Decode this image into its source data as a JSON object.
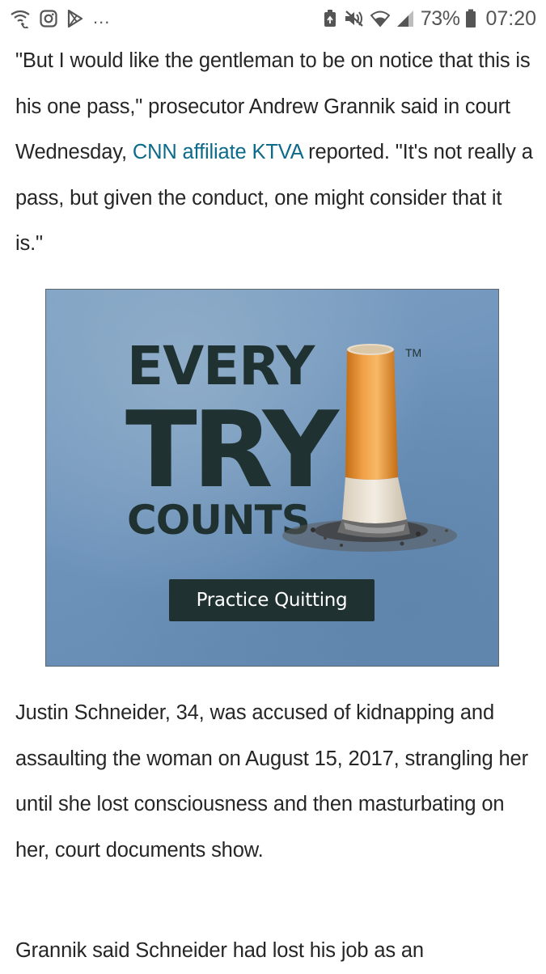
{
  "status_bar": {
    "left_icons": [
      "wifi-calling-icon",
      "instagram-icon",
      "play-store-icon"
    ],
    "more": "...",
    "right_icons": [
      "recycle-icon",
      "mute-icon",
      "wifi-icon",
      "signal-icon"
    ],
    "battery_percent": "73%",
    "battery_icon": "battery-icon",
    "time": "07:20"
  },
  "article": {
    "paragraph_1": {
      "before_link": "\"But I would like the gentleman to be on notice that this is his one pass,\" prosecutor Andrew Grannik said in court Wednesday, ",
      "link_text": "CNN affiliate KTVA",
      "after_link": " reported. \"It's not really a pass, but given the conduct, one might consider that it is.\""
    },
    "paragraph_2": "Justin Schneider, 34, was accused of kidnapping and assaulting the woman on August 15, 2017, strangling her until she lost consciousness and then masturbating on her, court documents show.",
    "paragraph_3": "Grannik said Schneider had lost his job as an"
  },
  "ad": {
    "line_1": "EVERY",
    "line_2": "TRY",
    "line_3": "COUNTS",
    "trademark": "TM",
    "button_label": "Practice Quitting",
    "colors": {
      "background": "#6e93bb",
      "text": "#1f3231",
      "button": "#1f3231"
    }
  },
  "colors": {
    "link": "#0d6a8a",
    "body_text": "#262626"
  }
}
